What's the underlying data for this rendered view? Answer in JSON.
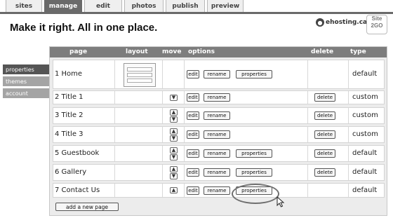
{
  "tabs": [
    {
      "label": "sites",
      "active": false
    },
    {
      "label": "manage",
      "active": true
    },
    {
      "label": "edit",
      "active": false
    },
    {
      "label": "photos",
      "active": false
    },
    {
      "label": "publish",
      "active": false
    },
    {
      "label": "preview",
      "active": false
    }
  ],
  "headline": "Make it right.  All in one place.",
  "logo": {
    "text": "ehosting.ca",
    "badge_top": "Site",
    "badge_bottom": "2GO",
    "icon": "ehosting-logo-icon"
  },
  "sidebar": {
    "items": [
      {
        "label": "properties",
        "active": true
      },
      {
        "label": "themes",
        "active": false
      },
      {
        "label": "account",
        "active": false
      }
    ]
  },
  "table": {
    "headers": {
      "page": "page",
      "layout": "layout",
      "move": "move",
      "options": "options",
      "delete": "delete",
      "type": "type"
    },
    "rows": [
      {
        "label": "1 Home",
        "type": "default",
        "edit": "edit",
        "rename": "rename",
        "properties": "properties"
      },
      {
        "label": "2 Title 1",
        "type": "custom",
        "edit": "edit",
        "rename": "rename",
        "delete": "delete"
      },
      {
        "label": "3 Title 2",
        "type": "custom",
        "edit": "edit",
        "rename": "rename",
        "delete": "delete"
      },
      {
        "label": "4 Title 3",
        "type": "custom",
        "edit": "edit",
        "rename": "rename",
        "delete": "delete"
      },
      {
        "label": "5 Guestbook",
        "type": "default",
        "edit": "edit",
        "rename": "rename",
        "properties": "properties",
        "delete": "delete"
      },
      {
        "label": "6 Gallery",
        "type": "default",
        "edit": "edit",
        "rename": "rename",
        "properties": "properties",
        "delete": "delete"
      },
      {
        "label": "7 Contact Us",
        "type": "default",
        "edit": "edit",
        "rename": "rename",
        "properties": "properties"
      }
    ]
  },
  "add_page_label": "add a new page",
  "colors": {
    "header_bar": "#7d7d7d",
    "active_tab": "#6a6a6a",
    "panel_bg": "#ececec"
  }
}
